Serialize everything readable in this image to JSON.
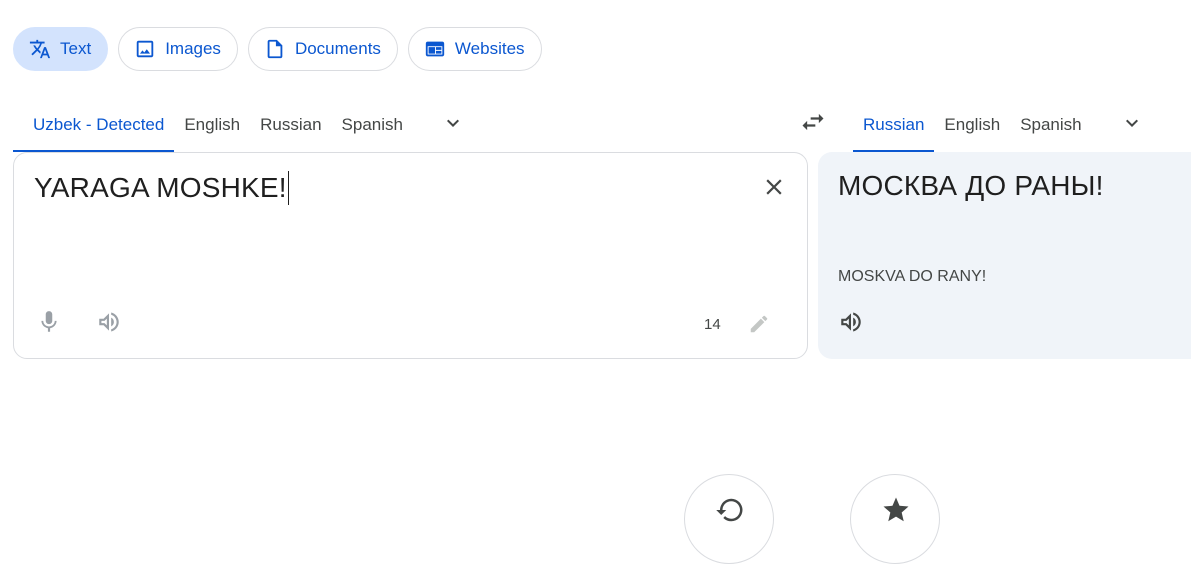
{
  "modes": [
    {
      "label": "Text",
      "icon": "translate-icon",
      "active": true
    },
    {
      "label": "Images",
      "icon": "image-icon",
      "active": false
    },
    {
      "label": "Documents",
      "icon": "document-icon",
      "active": false
    },
    {
      "label": "Websites",
      "icon": "website-icon",
      "active": false
    }
  ],
  "source_langs": [
    "Uzbek - Detected",
    "English",
    "Russian",
    "Spanish"
  ],
  "target_langs": [
    "Russian",
    "English",
    "Spanish"
  ],
  "source": {
    "text": "YARAGA MOSHKE!",
    "char_count": "14"
  },
  "target": {
    "text": "МОСКВА ДО РАНЫ!",
    "transliteration": "MOSKVA DO RANY!"
  },
  "colors": {
    "accent": "#0b57d0",
    "chip_active_bg": "#d3e3fd",
    "target_panel_bg": "#f0f4f9",
    "border": "#dadce0"
  }
}
